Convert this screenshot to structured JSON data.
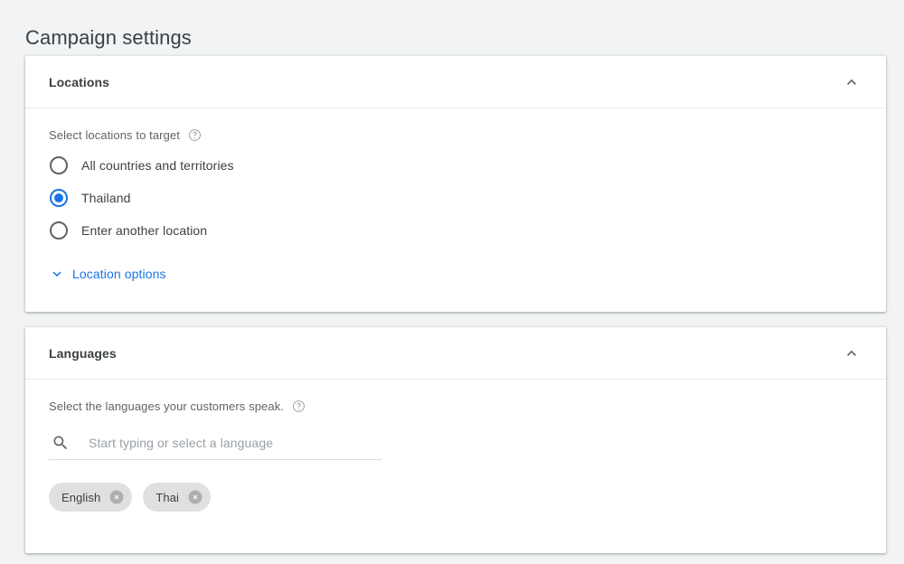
{
  "page": {
    "title": "Campaign settings",
    "background_color": "#f1f3f4",
    "accent_color": "#1a73e8"
  },
  "cards": {
    "locations": {
      "title": "Locations",
      "collapse_icon": "chevron-up-icon",
      "field_label": "Select locations to target",
      "help_icon": "help-circle-icon",
      "radio_options": [
        {
          "label": "All countries and territories",
          "selected": false
        },
        {
          "label": "Thailand",
          "selected": true
        },
        {
          "label": "Enter another location",
          "selected": false
        }
      ],
      "options_link": {
        "label": "Location options",
        "icon": "chevron-down-icon"
      }
    },
    "languages": {
      "title": "Languages",
      "collapse_icon": "chevron-up-icon",
      "field_label": "Select the languages your customers speak.",
      "help_icon": "help-circle-icon",
      "search": {
        "icon": "search-icon",
        "value": "",
        "placeholder": "Start typing or select a language"
      },
      "chips": [
        {
          "label": "English",
          "remove_icon": "close-circle-icon"
        },
        {
          "label": "Thai",
          "remove_icon": "close-circle-icon"
        }
      ]
    }
  }
}
